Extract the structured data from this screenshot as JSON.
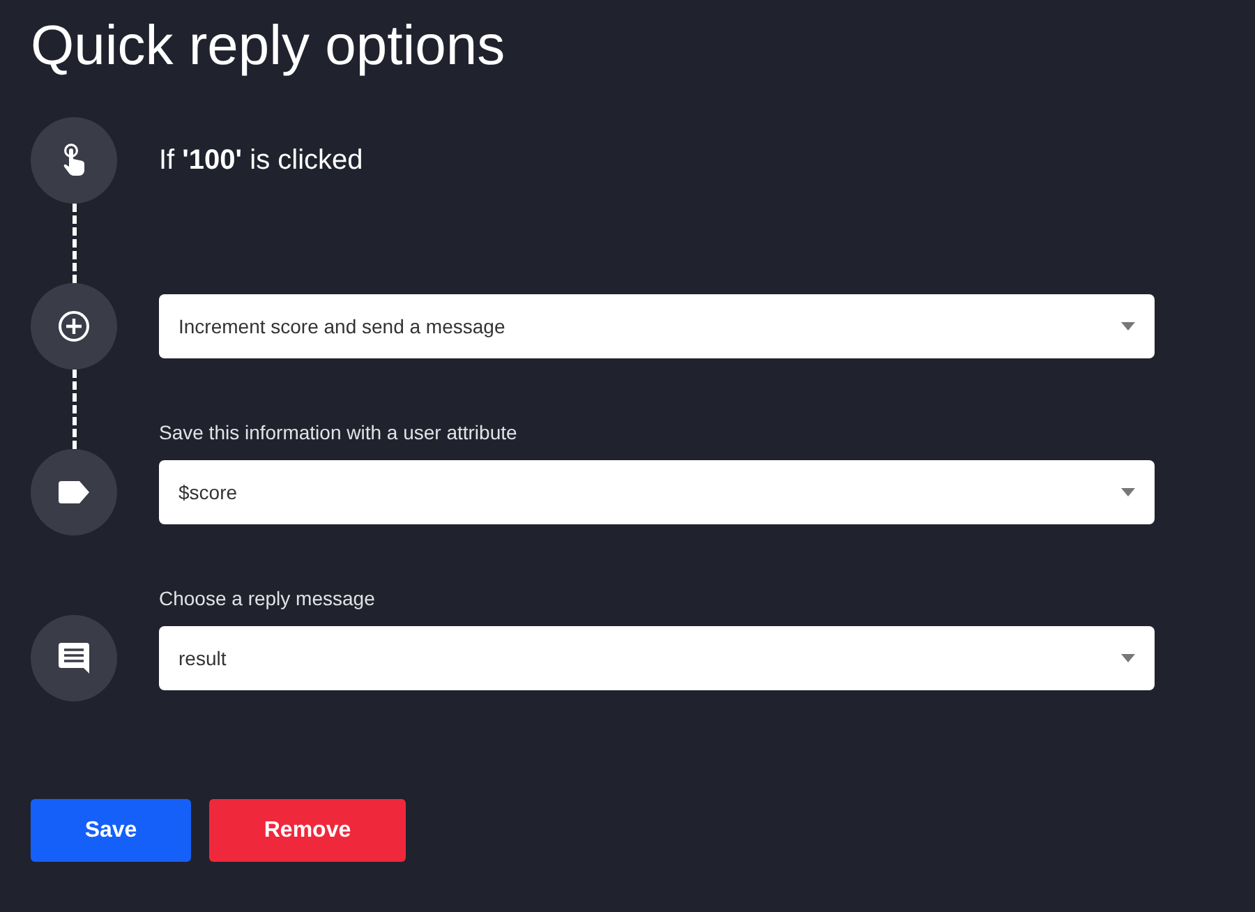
{
  "title": "Quick reply options",
  "steps": [
    {
      "kind": "trigger",
      "connector_above": false,
      "text": "If **'100'** is clicked"
    },
    {
      "kind": "action",
      "connector_above": true,
      "value": "Increment score and send a message"
    },
    {
      "kind": "attribute",
      "connector_above": true,
      "label": "Save this information with a user attribute",
      "value": "$score"
    },
    {
      "kind": "reply",
      "connector_above": false,
      "label": "Choose a reply message",
      "value": "result"
    }
  ],
  "buttons": [
    {
      "kind": "primary",
      "label": "Save"
    },
    {
      "kind": "danger",
      "label": "Remove"
    }
  ]
}
